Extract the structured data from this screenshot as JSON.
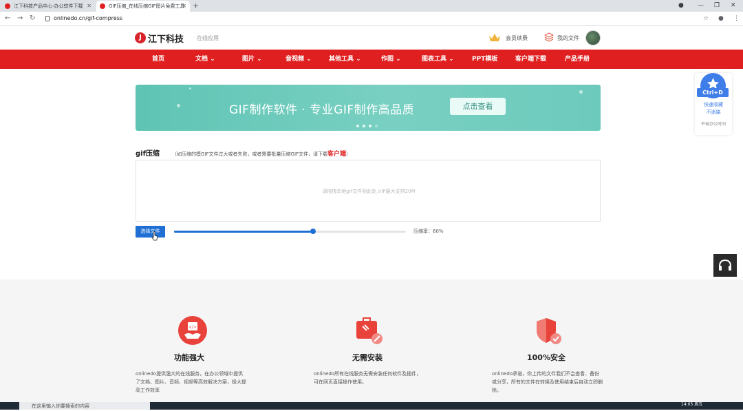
{
  "browser": {
    "tabs": [
      {
        "title": "江下科技产品中心-办公软件下载"
      },
      {
        "title": "GIF压缩_在线压缩GIF图片免费工具"
      }
    ],
    "new_tab": "+",
    "url": "onlinedo.cn/gif-compress"
  },
  "header": {
    "logo_text": "江下科技",
    "logo_sub": "在线应用",
    "member_label": "会员续费",
    "files_label": "我的文件"
  },
  "nav": {
    "items": [
      "首页",
      "文档",
      "图片",
      "音视频",
      "其他工具",
      "作图",
      "图表工具",
      "PPT模板",
      "客户端下载",
      "产品手册"
    ]
  },
  "banner": {
    "title": "GIF制作软件 · 专业GIF制作高品质",
    "button": "点击查看"
  },
  "tool": {
    "title": "gif压缩",
    "note_prefix": "（如压缩的模GIF文件过大或者失败，或者需要批量压缩GIF文件，请下载",
    "note_link": "客户端",
    "note_suffix": "）",
    "drop_hint": "请拖拽本地gif文件到此处,VIP最大支持20M",
    "choose_button": "选择文件",
    "compression_rate": 0.6,
    "rate_label": "压缩率：60%"
  },
  "features": [
    {
      "title": "功能强大",
      "desc": "onlinedo提供强大的在线服务，在办公领域中提供了文档、图片、音频、视频等高效解决方案，极大提高工作效率",
      "icon": "code-hand-icon"
    },
    {
      "title": "无需安装",
      "desc": "onlinedo所有在线服务无需安装任何软件及插件，可在网页直接操作使用。",
      "icon": "toolbox-icon"
    },
    {
      "title": "100%安全",
      "desc": "onlinedo承诺，你上传的文件我们不会查看、备份或分享，所有的文件在转换及使用结束后自动立即删除。",
      "icon": "shield-check-icon"
    }
  ],
  "float_panel": {
    "key": "Ctrl+D",
    "line1": "快速收藏",
    "line2": "不迷路",
    "sub": "节省办公时间"
  },
  "taskbar": {
    "search_placeholder": "在这里输入你要搜索的内容",
    "time": "14:05 周五"
  },
  "colors": {
    "nav_red": "#e02020",
    "primary_blue": "#1f6fd4",
    "banner_teal": "#6ccabc"
  }
}
